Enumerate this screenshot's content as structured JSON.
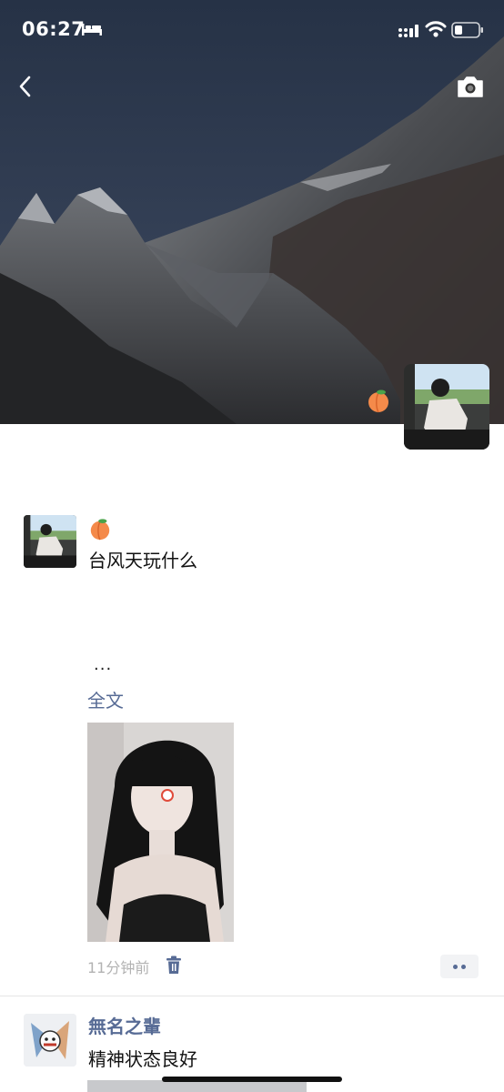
{
  "status_bar": {
    "time": "06:27"
  },
  "cover": {
    "owner_badge_emoji": "🍑"
  },
  "posts": [
    {
      "emoji": "🍑",
      "text": "台风天玩什么",
      "ellipsis": "...",
      "full_text_link": "全文",
      "time": "11分钟前"
    },
    {
      "name": "無名之輩",
      "text": "精神状态良好"
    }
  ],
  "colors": {
    "link": "#576b95",
    "timestamp": "#b2b2b2"
  }
}
